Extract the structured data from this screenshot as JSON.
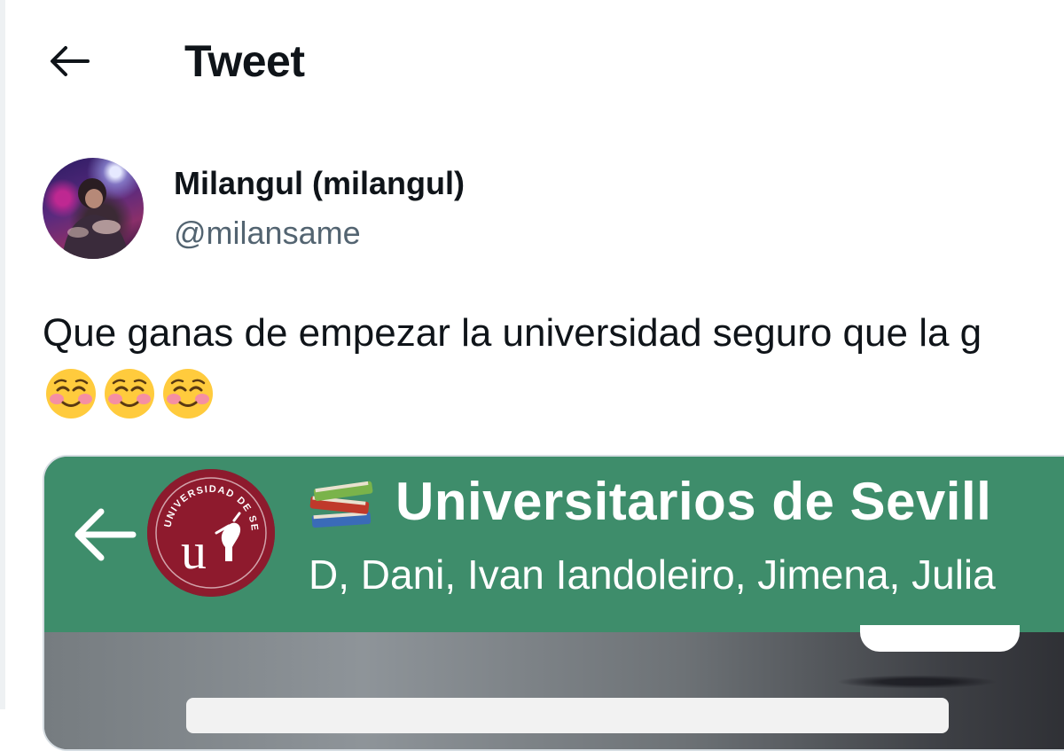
{
  "header": {
    "title": "Tweet"
  },
  "tweet": {
    "author": {
      "display_name": "Milangul (milangul)",
      "handle": "@milansame"
    },
    "text": "Que ganas de empezar la universidad seguro que la g",
    "emojis": [
      "smiling-face-icon",
      "smiling-face-icon",
      "smiling-face-icon"
    ]
  },
  "media": {
    "chat_header": {
      "group_name": "Universitarios de Sevill",
      "members": "D, Dani, Ivan Iandoleiro, Jimena, Julia",
      "logo_text": "UNIVERSIDAD DE SEVILLA",
      "accent": "#3e8d6b",
      "logo_color": "#8e1a2d"
    }
  }
}
